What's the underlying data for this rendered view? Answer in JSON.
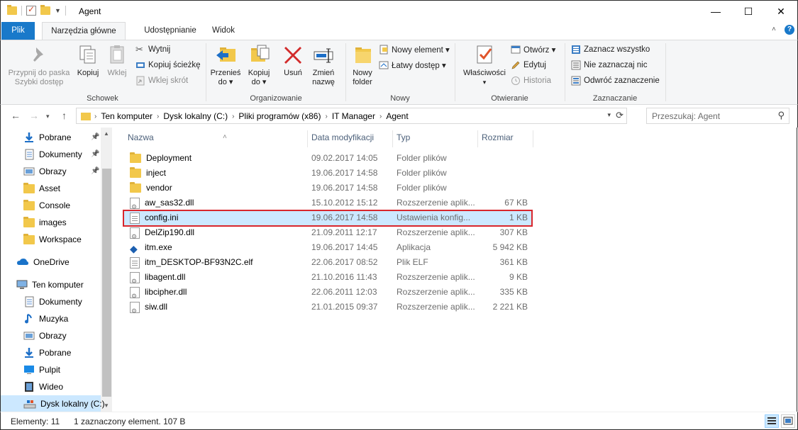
{
  "window": {
    "title": "Agent",
    "minimize": "—",
    "maximize": "☐",
    "close": "✕"
  },
  "tabs": {
    "file": "Plik",
    "home": "Narzędzia główne",
    "share": "Udostępnianie",
    "view": "Widok"
  },
  "ribbon": {
    "clipboard": {
      "label": "Schowek",
      "pin": "Przypnij do paska\nSzybki dostęp",
      "pin_l1": "Przypnij do paska",
      "pin_l2": "Szybki dostęp",
      "copy": "Kopiuj",
      "paste": "Wklej",
      "cut": "Wytnij",
      "copy_path": "Kopiuj ścieżkę",
      "paste_shortcut": "Wklej skrót"
    },
    "organize": {
      "label": "Organizowanie",
      "move_l1": "Przenieś",
      "move_l2": "do ▾",
      "copy_l1": "Kopiuj",
      "copy_l2": "do ▾",
      "delete": "Usuń",
      "rename_l1": "Zmień",
      "rename_l2": "nazwę"
    },
    "new": {
      "label": "Nowy",
      "folder_l1": "Nowy",
      "folder_l2": "folder",
      "new_item": "Nowy element ▾",
      "easy_access": "Łatwy dostęp ▾"
    },
    "open": {
      "label": "Otwieranie",
      "properties": "Właściwości",
      "open": "Otwórz ▾",
      "edit": "Edytuj",
      "history": "Historia"
    },
    "select": {
      "label": "Zaznaczanie",
      "select_all": "Zaznacz wszystko",
      "select_none": "Nie zaznaczaj nic",
      "invert": "Odwróć zaznaczenie"
    }
  },
  "address": {
    "crumbs": [
      "Ten komputer",
      "Dysk lokalny (C:)",
      "Pliki programów (x86)",
      "IT Manager",
      "Agent"
    ],
    "search_placeholder": "Przeszukaj: Agent"
  },
  "nav": {
    "items": [
      {
        "label": "Pobrane",
        "icon": "download-icon",
        "pinned": true
      },
      {
        "label": "Dokumenty",
        "icon": "documents-icon",
        "pinned": true
      },
      {
        "label": "Obrazy",
        "icon": "pictures-icon",
        "pinned": true
      },
      {
        "label": "Asset",
        "icon": "folder-icon"
      },
      {
        "label": "Console",
        "icon": "folder-icon"
      },
      {
        "label": "images",
        "icon": "folder-icon"
      },
      {
        "label": "Workspace",
        "icon": "folder-icon"
      },
      {
        "label": "OneDrive",
        "icon": "cloud-icon"
      },
      {
        "label": "Ten komputer",
        "icon": "computer-icon"
      },
      {
        "label": "Dokumenty",
        "icon": "documents-icon"
      },
      {
        "label": "Muzyka",
        "icon": "music-icon"
      },
      {
        "label": "Obrazy",
        "icon": "pictures-icon"
      },
      {
        "label": "Pobrane",
        "icon": "download-icon"
      },
      {
        "label": "Pulpit",
        "icon": "desktop-icon"
      },
      {
        "label": "Wideo",
        "icon": "video-icon"
      },
      {
        "label": "Dysk lokalny (C:)",
        "icon": "drive-icon",
        "selected": true
      }
    ]
  },
  "columns": {
    "name": "Nazwa",
    "date": "Data modyfikacji",
    "type": "Typ",
    "size": "Rozmiar"
  },
  "files": [
    {
      "name": "Deployment",
      "date": "09.02.2017 14:05",
      "type": "Folder plików",
      "size": "",
      "icon": "folder-icon"
    },
    {
      "name": "inject",
      "date": "19.06.2017 14:58",
      "type": "Folder plików",
      "size": "",
      "icon": "folder-icon"
    },
    {
      "name": "vendor",
      "date": "19.06.2017 14:58",
      "type": "Folder plików",
      "size": "",
      "icon": "folder-icon"
    },
    {
      "name": "aw_sas32.dll",
      "date": "15.10.2012 15:12",
      "type": "Rozszerzenie aplik...",
      "size": "67 KB",
      "icon": "dll-file-icon"
    },
    {
      "name": "config.ini",
      "date": "19.06.2017 14:58",
      "type": "Ustawienia konfig...",
      "size": "1 KB",
      "icon": "ini-file-icon",
      "selected": true
    },
    {
      "name": "DelZip190.dll",
      "date": "21.09.2011 12:17",
      "type": "Rozszerzenie aplik...",
      "size": "307 KB",
      "icon": "dll-file-icon"
    },
    {
      "name": "itm.exe",
      "date": "19.06.2017 14:45",
      "type": "Aplikacja",
      "size": "5 942 KB",
      "icon": "exe-file-icon"
    },
    {
      "name": "itm_DESKTOP-BF93N2C.elf",
      "date": "22.06.2017 08:52",
      "type": "Plik ELF",
      "size": "361 KB",
      "icon": "generic-file-icon"
    },
    {
      "name": "libagent.dll",
      "date": "21.10.2016 11:43",
      "type": "Rozszerzenie aplik...",
      "size": "9 KB",
      "icon": "dll-file-icon"
    },
    {
      "name": "libcipher.dll",
      "date": "22.06.2011 12:03",
      "type": "Rozszerzenie aplik...",
      "size": "335 KB",
      "icon": "dll-file-icon"
    },
    {
      "name": "siw.dll",
      "date": "21.01.2015 09:37",
      "type": "Rozszerzenie aplik...",
      "size": "2 221 KB",
      "icon": "dll-file-icon"
    }
  ],
  "status": {
    "count": "Elementy: 11",
    "selection": "1 zaznaczony element. 107 B"
  },
  "colors": {
    "accent": "#1979ca",
    "selection": "#cce8ff",
    "highlight_border": "#d9262c"
  }
}
